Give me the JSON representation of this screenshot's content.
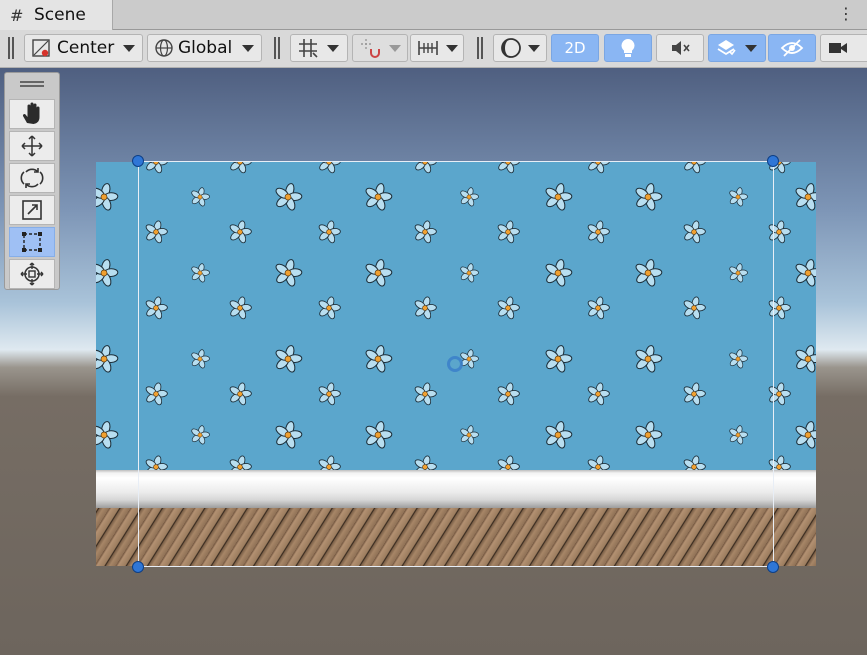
{
  "tab": {
    "icon": "grid-hash-icon",
    "icon_glyph": "#",
    "title": "Scene",
    "menu_glyph": "⋮"
  },
  "toolbar": {
    "pivot_mode": "Center",
    "pivot_rotation": "Global",
    "view_2d_label": "2D",
    "mode_2d_active": true,
    "lighting_active": true,
    "audio_active": false,
    "effects_active": true,
    "hidden_objects_active": true
  },
  "tools": [
    {
      "name": "hand-tool",
      "active": false
    },
    {
      "name": "move-tool",
      "active": false
    },
    {
      "name": "rotate-tool",
      "active": false
    },
    {
      "name": "scale-tool",
      "active": false
    },
    {
      "name": "rect-tool",
      "active": true
    },
    {
      "name": "transform-tool",
      "active": false
    }
  ],
  "colors": {
    "accent": "#8ab6f3",
    "wallpaper": "#5ba6cc",
    "flower_petal": "#b8def0",
    "flower_center": "#f0a030",
    "handle": "#2f76d6"
  }
}
